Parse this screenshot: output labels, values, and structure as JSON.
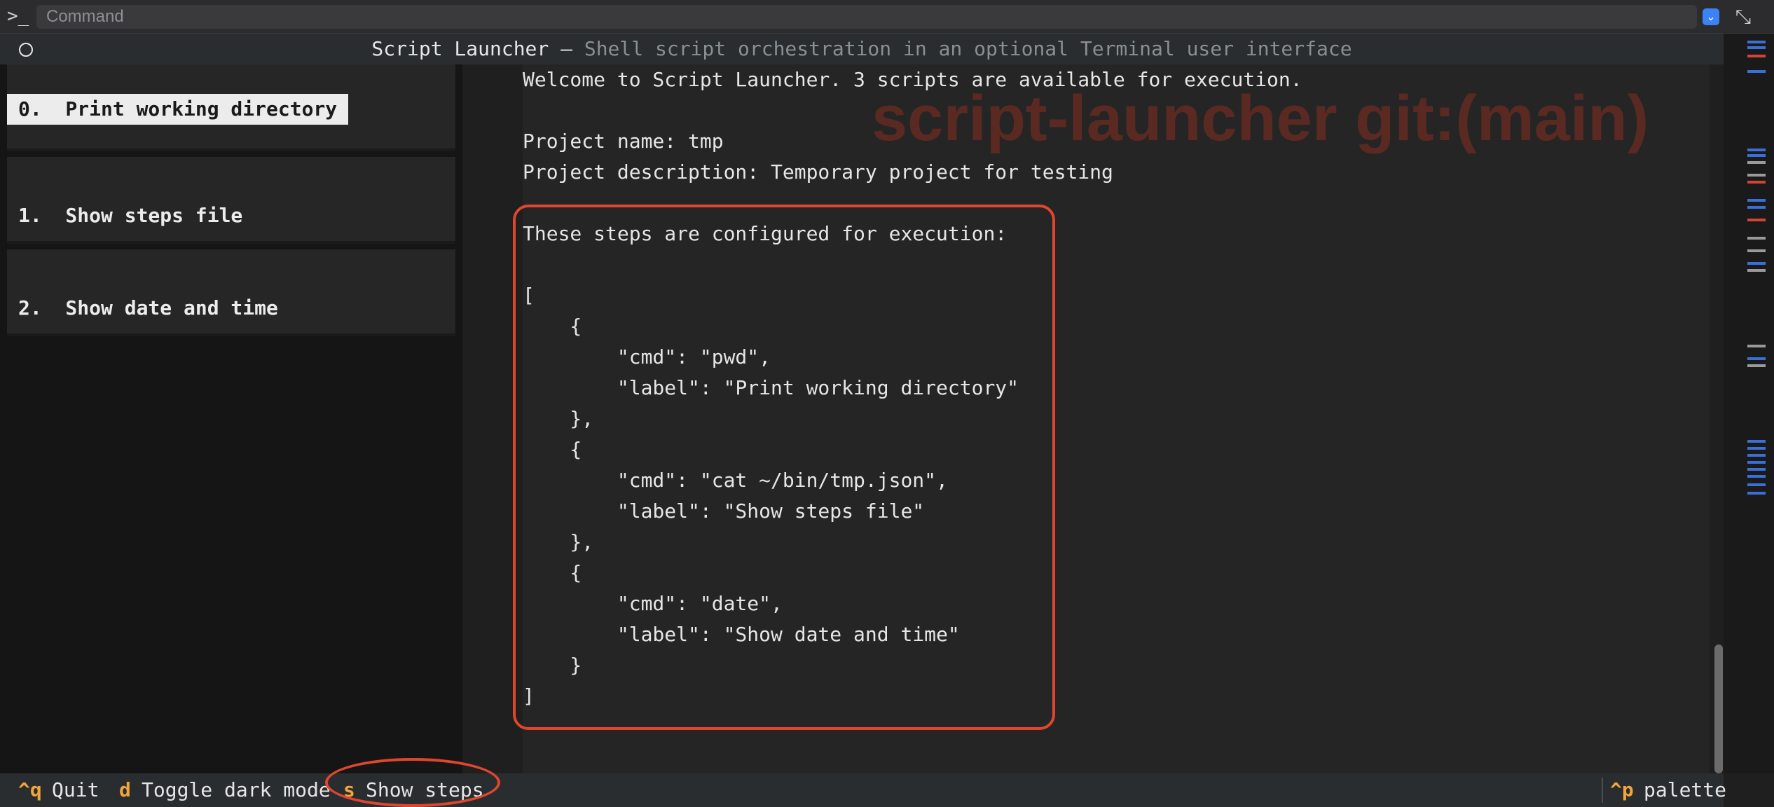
{
  "command_bar": {
    "placeholder": "Command",
    "prompt_icon": "terminal-icon",
    "dropdown_icon": "chevron-down-icon",
    "expand_icon": "expand-icon"
  },
  "title": {
    "main": "Script Launcher – ",
    "sub": "Shell script orchestration in an optional Terminal user interface"
  },
  "sidebar": {
    "items": [
      {
        "label": "0.  Print working directory",
        "selected": true
      },
      {
        "label": "1.  Show steps file",
        "selected": false
      },
      {
        "label": "2.  Show date and time",
        "selected": false
      }
    ]
  },
  "watermark": "script-launcher git:(main)",
  "content": {
    "lines": [
      "Welcome to Script Launcher. 3 scripts are available for execution.",
      "",
      "Project name: tmp",
      "Project description: Temporary project for testing",
      "",
      "These steps are configured for execution:",
      "",
      "[",
      "    {",
      "        \"cmd\": \"pwd\",",
      "        \"label\": \"Print working directory\"",
      "    },",
      "    {",
      "        \"cmd\": \"cat ~/bin/tmp.json\",",
      "        \"label\": \"Show steps file\"",
      "    },",
      "    {",
      "        \"cmd\": \"date\",",
      "        \"label\": \"Show date and time\"",
      "    }",
      "]"
    ]
  },
  "footer": {
    "bindings": [
      {
        "key": "^q",
        "label": "Quit"
      },
      {
        "key": "d",
        "label": "Toggle dark mode"
      },
      {
        "key": "s",
        "label": "Show steps"
      }
    ],
    "palette": {
      "key": "^p",
      "label": "palette"
    }
  },
  "colors": {
    "accent_key": "#f3a53b",
    "annotation_red": "#e0462f",
    "watermark": "#5a2a22",
    "scroll_blue": "#3b6fd8",
    "scroll_red": "#d0443a",
    "scroll_gray": "#9a9a9a"
  }
}
